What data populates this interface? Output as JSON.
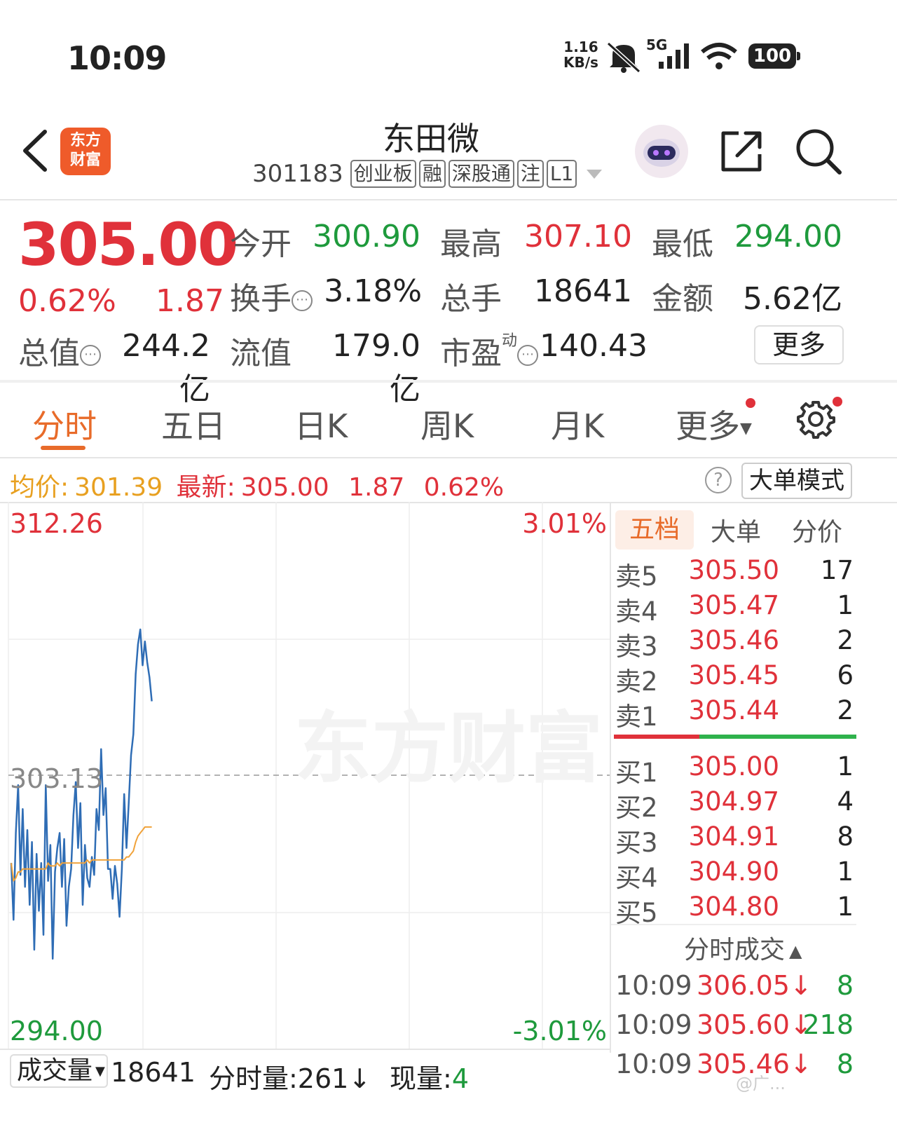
{
  "status_bar": {
    "time": "10:09",
    "net_speed_value": "1.16",
    "net_speed_unit": "KB/s",
    "network": "5G",
    "battery": "100"
  },
  "header": {
    "logo_text": "东方财富",
    "stock_name": "东田微",
    "stock_code": "301183",
    "tags": [
      "创业板",
      "融",
      "深股通",
      "注",
      "L1"
    ]
  },
  "quote": {
    "price": "305.00",
    "change_pct": "0.62%",
    "change_val": "1.87",
    "open_label": "今开",
    "open": "300.90",
    "high_label": "最高",
    "high": "307.10",
    "low_label": "最低",
    "low": "294.00",
    "turnover_label": "换手",
    "turnover": "3.18%",
    "volume_label": "总手",
    "volume": "18641",
    "amount_label": "金额",
    "amount": "5.62亿",
    "mktcap_label": "总值",
    "mktcap": "244.2亿",
    "float_label": "流值",
    "float_cap": "179.0亿",
    "pe_label": "市盈",
    "pe_sup": "动",
    "pe": "140.43",
    "more_label": "更多"
  },
  "tabs": [
    "分时",
    "五日",
    "日K",
    "周K",
    "月K",
    "更多"
  ],
  "info_line": {
    "avg_label": "均价:",
    "avg": "301.39",
    "latest_label": "最新:",
    "latest": "305.00",
    "change_val": "1.87",
    "change_pct": "0.62%",
    "help": "?",
    "big_order_mode": "大单模式"
  },
  "chart_data": {
    "type": "line",
    "y_max_label": "312.26",
    "y_min_label": "294.00",
    "y_mid_label": "303.13",
    "pct_max_label": "3.01%",
    "pct_min_label": "-3.01%",
    "ylim": [
      294.0,
      312.26
    ],
    "watermark": "东方财富",
    "series": [
      {
        "values": [
          300.2,
          298.3,
          301.2,
          302.8,
          299.8,
          302.0,
          299.4,
          301.3,
          298.8,
          300.9,
          297.3,
          300.5,
          298.6,
          300.2,
          297.8,
          302.8,
          299.6,
          300.8,
          297.0,
          299.9,
          300.7,
          301.2,
          299.4,
          301.0,
          298.1,
          299.4,
          300.0,
          301.8,
          302.9,
          300.7,
          302.2,
          298.8,
          300.8,
          299.7,
          299.4,
          300.4,
          299.8,
          302.0,
          301.3,
          304.0,
          301.8,
          302.7,
          300.0,
          300.0,
          299.0,
          300.1,
          299.5,
          298.4,
          300.0,
          302.5,
          300.7,
          302.2,
          303.8,
          304.5,
          306.5,
          307.5,
          308.0,
          306.8,
          307.6,
          306.9,
          306.4,
          305.6
        ]
      },
      {
        "values": [
          300.2,
          299.6,
          299.7,
          299.9,
          299.9,
          300.0,
          300.0,
          300.0,
          300.0,
          300.0,
          300.0,
          300.0,
          300.0,
          300.0,
          300.0,
          300.0,
          300.2,
          300.1,
          300.1,
          300.1,
          300.2,
          300.1,
          300.2,
          300.2,
          300.2,
          300.2,
          300.2,
          300.2,
          300.2,
          300.2,
          300.2,
          300.2,
          300.2,
          300.3,
          300.2,
          300.3,
          300.3,
          300.3,
          300.3,
          300.3,
          300.3,
          300.3,
          300.3,
          300.3,
          300.3,
          300.3,
          300.3,
          300.3,
          300.3,
          300.3,
          300.4,
          300.4,
          300.5,
          300.6,
          300.9,
          301.1,
          301.2,
          301.3,
          301.4,
          301.4,
          301.4,
          301.4
        ]
      }
    ]
  },
  "order_book": {
    "tabs": [
      "五档",
      "大单",
      "分价"
    ],
    "asks": [
      {
        "label": "卖5",
        "price": "305.50",
        "vol": "17"
      },
      {
        "label": "卖4",
        "price": "305.47",
        "vol": "1"
      },
      {
        "label": "卖3",
        "price": "305.46",
        "vol": "2"
      },
      {
        "label": "卖2",
        "price": "305.45",
        "vol": "6"
      },
      {
        "label": "卖1",
        "price": "305.44",
        "vol": "2"
      }
    ],
    "bids": [
      {
        "label": "买1",
        "price": "305.00",
        "vol": "1"
      },
      {
        "label": "买2",
        "price": "304.97",
        "vol": "4"
      },
      {
        "label": "买3",
        "price": "304.91",
        "vol": "8"
      },
      {
        "label": "买4",
        "price": "304.90",
        "vol": "1"
      },
      {
        "label": "买5",
        "price": "304.80",
        "vol": "1"
      }
    ],
    "tape_title": "分时成交",
    "tape": [
      {
        "time": "10:09",
        "price": "306.05↓",
        "vol": "8"
      },
      {
        "time": "10:09",
        "price": "305.60↓",
        "vol": "218"
      },
      {
        "time": "10:09",
        "price": "305.46↓",
        "vol": "8"
      }
    ]
  },
  "bottom": {
    "vol_select": "成交量",
    "vol_value": "18641",
    "minute_vol": "分时量:261↓",
    "current_label": "现量:",
    "current_value": "4",
    "watermark": "@广..."
  },
  "colors": {
    "up": "#e0313a",
    "down": "#1e9a3c",
    "accent": "#e86b2a",
    "price_line": "#2f6db5",
    "avg_line": "#f0a23a"
  }
}
